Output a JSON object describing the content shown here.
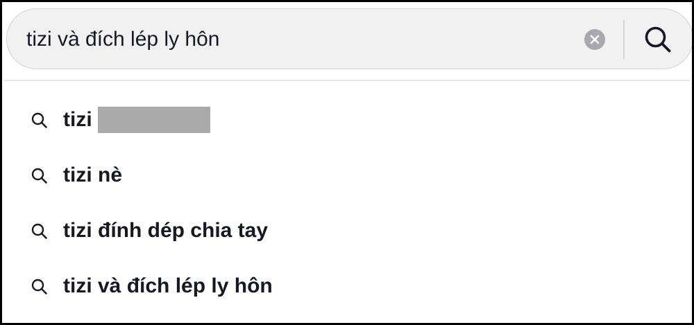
{
  "search": {
    "value": "tizi và đích lép ly hôn",
    "clear_icon": "clear-circle-icon",
    "submit_icon": "search-icon"
  },
  "suggestions": [
    {
      "label": "tizi",
      "icon": "search-icon",
      "redacted": true
    },
    {
      "label": "tizi nè",
      "icon": "search-icon"
    },
    {
      "label": "tizi đính dép chia tay",
      "icon": "search-icon"
    },
    {
      "label": "tizi và đích lép ly hôn",
      "icon": "search-icon"
    }
  ],
  "colors": {
    "search_bg": "#f1f1f2",
    "text": "#161823",
    "clear_icon": "#a9a9ad",
    "redaction": "#aaaaaa"
  }
}
